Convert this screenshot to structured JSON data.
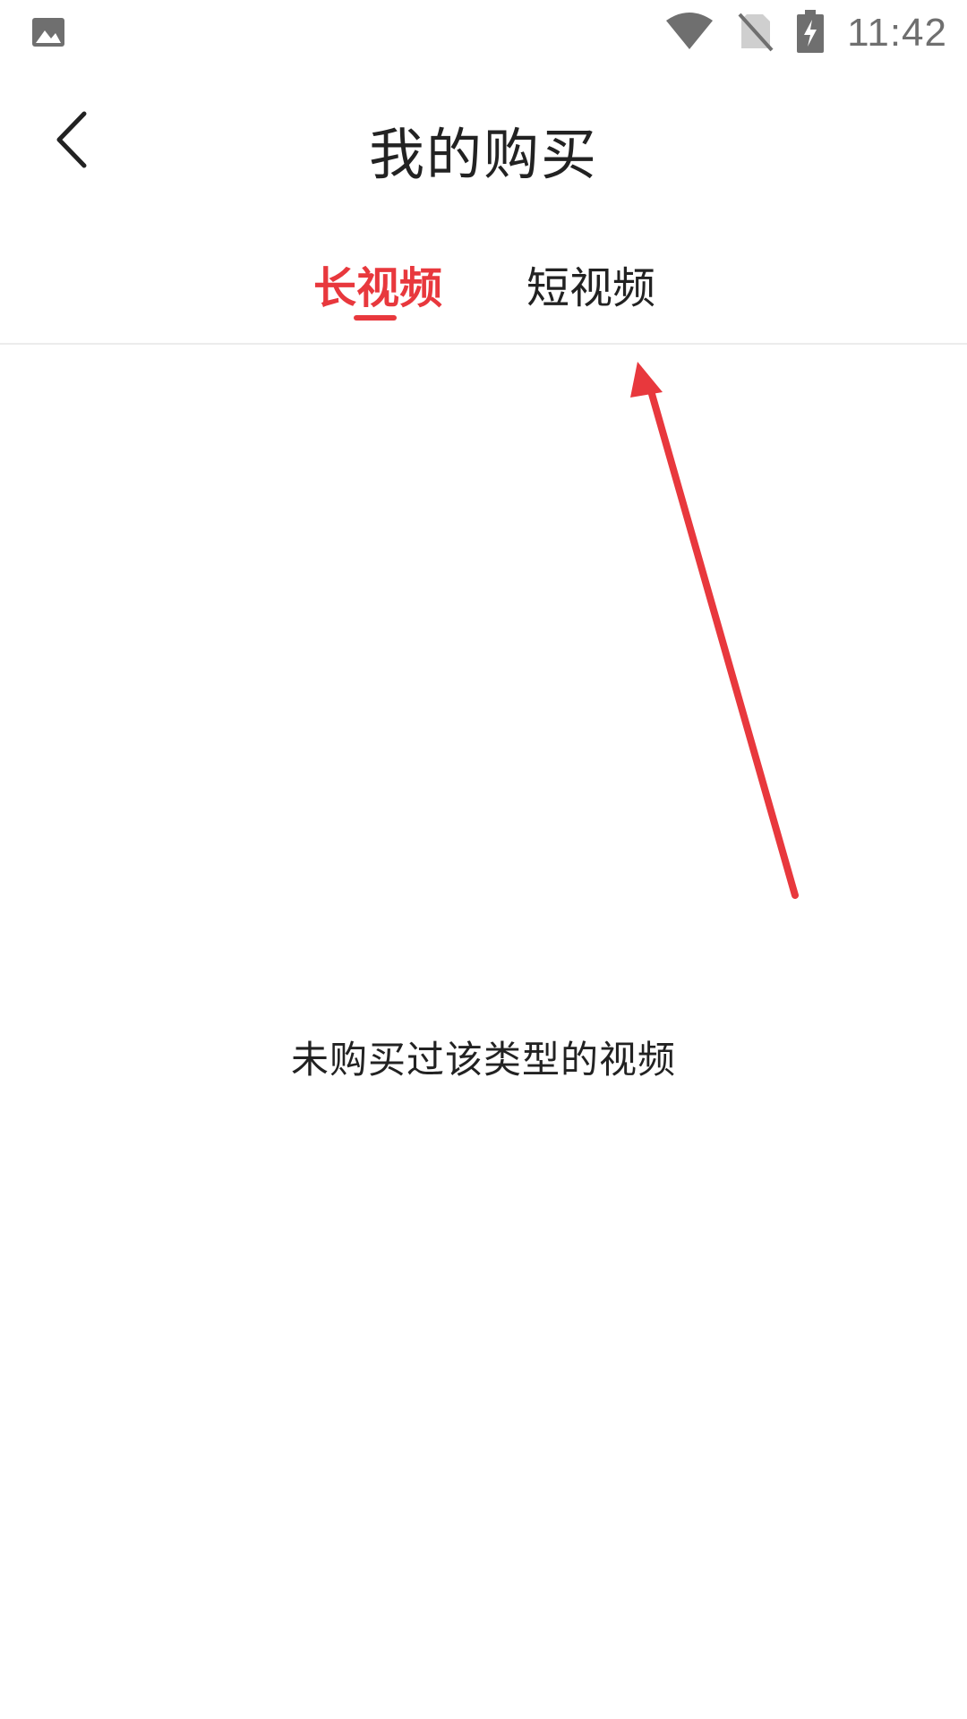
{
  "status_bar": {
    "time": "11:42",
    "icons": [
      "gallery-notification-icon",
      "wifi-icon",
      "no-sim-icon",
      "battery-charging-icon"
    ]
  },
  "header": {
    "title": "我的购买",
    "back_icon": "back-chevron-icon"
  },
  "tabs": {
    "items": [
      {
        "label": "长视频",
        "selected": true
      },
      {
        "label": "短视频",
        "selected": false
      }
    ]
  },
  "empty_state": {
    "message": "未购买过该类型的视频"
  },
  "annotation": {
    "type": "red-arrow",
    "color": "#e8383d",
    "points_to": "短视频 tab"
  },
  "colors": {
    "accent": "#e8383d",
    "text": "#222222",
    "status_icons": "#6f6f6f"
  }
}
